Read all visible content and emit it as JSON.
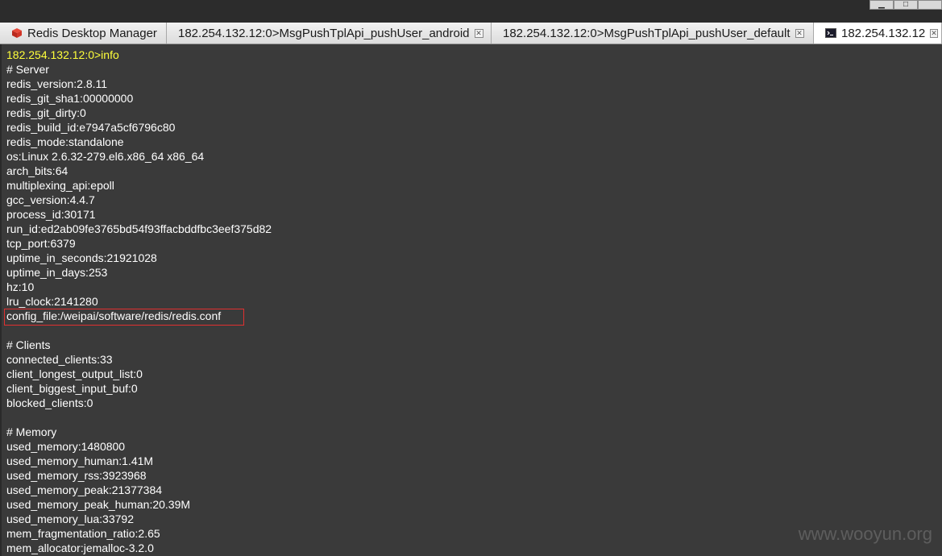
{
  "window": {
    "minimize_glyph": "▁",
    "maximize_glyph": "□"
  },
  "tabs": [
    {
      "label": "Redis Desktop Manager",
      "icon": "redis-cube-icon",
      "closable": false,
      "active": false
    },
    {
      "label": "182.254.132.12:0>MsgPushTplApi_pushUser_android",
      "icon": null,
      "closable": true,
      "active": false
    },
    {
      "label": "182.254.132.12:0>MsgPushTplApi_pushUser_default",
      "icon": null,
      "closable": true,
      "active": false
    },
    {
      "label": "182.254.132.12",
      "icon": "console-icon",
      "closable": true,
      "active": true
    }
  ],
  "terminal": {
    "prompt": "182.254.132.12:0>info",
    "lines": [
      "# Server",
      "redis_version:2.8.11",
      "redis_git_sha1:00000000",
      "redis_git_dirty:0",
      "redis_build_id:e7947a5cf6796c80",
      "redis_mode:standalone",
      "os:Linux 2.6.32-279.el6.x86_64 x86_64",
      "arch_bits:64",
      "multiplexing_api:epoll",
      "gcc_version:4.4.7",
      "process_id:30171",
      "run_id:ed2ab09fe3765bd54f93ffacbddfbc3eef375d82",
      "tcp_port:6379",
      "uptime_in_seconds:21921028",
      "uptime_in_days:253",
      "hz:10",
      "lru_clock:2141280",
      "config_file:/weipai/software/redis/redis.conf",
      "",
      "# Clients",
      "connected_clients:33",
      "client_longest_output_list:0",
      "client_biggest_input_buf:0",
      "blocked_clients:0",
      "",
      "# Memory",
      "used_memory:1480800",
      "used_memory_human:1.41M",
      "used_memory_rss:3923968",
      "used_memory_peak:21377384",
      "used_memory_peak_human:20.39M",
      "used_memory_lua:33792",
      "mem_fragmentation_ratio:2.65",
      "mem_allocator:jemalloc-3.2.0"
    ],
    "prompt_color": "#ffff3a",
    "text_color": "#ffffff",
    "background_color": "#3a3a3a",
    "highlight_color": "#e03030"
  },
  "watermark": "www.wooyun.org"
}
